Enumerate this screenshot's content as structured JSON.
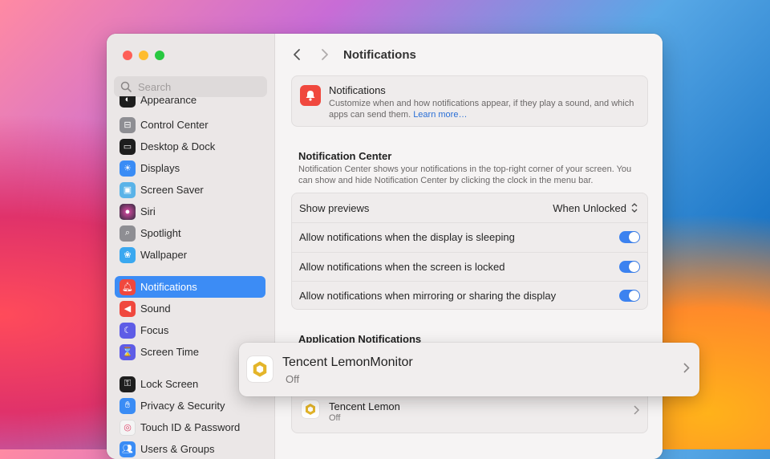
{
  "window": {
    "title": "Notifications"
  },
  "search": {
    "placeholder": "Search"
  },
  "sidebar": {
    "items": [
      {
        "label": "Appearance",
        "icon": "appearance-icon",
        "color": "#1e1e1e"
      },
      {
        "label": "Control Center",
        "icon": "control-center-icon",
        "color": "#8e8e93"
      },
      {
        "label": "Desktop & Dock",
        "icon": "desktop-dock-icon",
        "color": "#1e1e1e"
      },
      {
        "label": "Displays",
        "icon": "displays-icon",
        "color": "#3a8cf5"
      },
      {
        "label": "Screen Saver",
        "icon": "screen-saver-icon",
        "color": "#5ab3e8"
      },
      {
        "label": "Siri",
        "icon": "siri-icon",
        "color": "#2b2b3a"
      },
      {
        "label": "Spotlight",
        "icon": "spotlight-icon",
        "color": "#8e8e93"
      },
      {
        "label": "Wallpaper",
        "icon": "wallpaper-icon",
        "color": "#3aa8f0"
      },
      {
        "label": "Notifications",
        "icon": "notifications-icon",
        "color": "#f0483e"
      },
      {
        "label": "Sound",
        "icon": "sound-icon",
        "color": "#f0483e"
      },
      {
        "label": "Focus",
        "icon": "focus-icon",
        "color": "#5e5ce6"
      },
      {
        "label": "Screen Time",
        "icon": "screen-time-icon",
        "color": "#5e5ce6"
      },
      {
        "label": "Lock Screen",
        "icon": "lock-screen-icon",
        "color": "#1e1e1e"
      },
      {
        "label": "Privacy & Security",
        "icon": "privacy-hand-icon",
        "color": "#3a8cf5"
      },
      {
        "label": "Touch ID & Password",
        "icon": "fingerprint-icon",
        "color": "#f4f4f4"
      },
      {
        "label": "Users & Groups",
        "icon": "users-icon",
        "color": "#3a8cf5"
      }
    ],
    "active": "Notifications"
  },
  "main": {
    "hero": {
      "title": "Notifications",
      "desc": "Customize when and how notifications appear, if they play a sound, and which apps can send them.",
      "link": "Learn more…"
    },
    "notification_center": {
      "title": "Notification Center",
      "desc": "Notification Center shows your notifications in the top-right corner of your screen. You can show and hide Notification Center by clicking the clock in the menu bar."
    },
    "settings": [
      {
        "label": "Show previews",
        "value": "When Unlocked"
      },
      {
        "label": "Allow notifications when the display is sleeping",
        "on": true
      },
      {
        "label": "Allow notifications when the screen is locked",
        "on": true
      },
      {
        "label": "Allow notifications when mirroring or sharing the display",
        "on": true
      }
    ],
    "app_notifications": {
      "title": "Application Notifications",
      "apps": [
        {
          "name": "Tencent Lemon",
          "status": "Off"
        }
      ]
    }
  },
  "highlight": {
    "name": "Tencent LemonMonitor",
    "status": "Off"
  },
  "colors": {
    "accent": "#3c8cf5",
    "toggle_on": "#3c82f0",
    "link": "#2a6fd6"
  }
}
